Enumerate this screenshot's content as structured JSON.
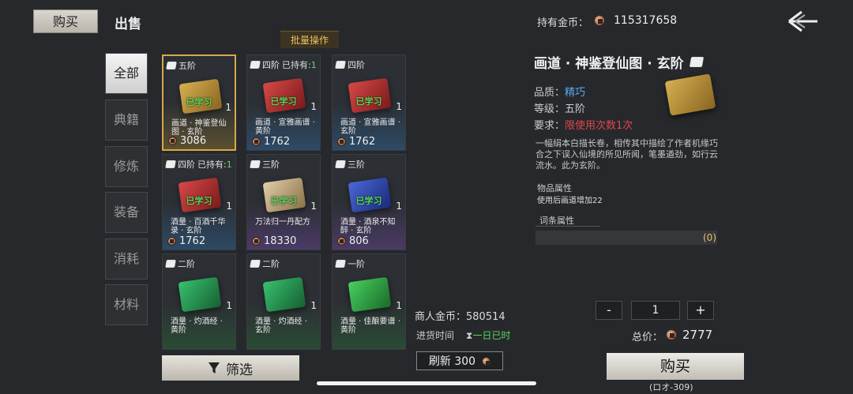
{
  "header": {
    "tab_buy": "购买",
    "tab_sell": "出售",
    "gold_label": "持有金币：",
    "gold_value": "115317658",
    "batch_label": "批量操作"
  },
  "categories": [
    "全部",
    "典籍",
    "修炼",
    "装备",
    "消耗",
    "材料"
  ],
  "items": [
    {
      "tier": "五阶",
      "owned_label": "",
      "owned_count": "",
      "learned": "已学习",
      "qty": "1",
      "name": "画道 · 神鉴登仙图 · 玄阶",
      "price": "3086"
    },
    {
      "tier": "四阶",
      "owned_label": "已持有:",
      "owned_count": "1",
      "learned": "已学习",
      "qty": "1",
      "name": "画道 · 宣雅画谱 · 黄阶",
      "price": "1762"
    },
    {
      "tier": "四阶",
      "owned_label": "",
      "owned_count": "",
      "learned": "已学习",
      "qty": "1",
      "name": "画道 · 宣雅画谱 · 玄阶",
      "price": "1762"
    },
    {
      "tier": "四阶",
      "owned_label": "已持有:",
      "owned_count": "1",
      "learned": "已学习",
      "qty": "1",
      "name": "酒量 · 百酒千华录 · 玄阶",
      "price": "1762"
    },
    {
      "tier": "三阶",
      "owned_label": "",
      "owned_count": "",
      "learned": "已学习",
      "qty": "1",
      "name": "万法归一丹配方",
      "price": "18330"
    },
    {
      "tier": "三阶",
      "owned_label": "",
      "owned_count": "",
      "learned": "已学习",
      "qty": "1",
      "name": "酒量 · 酒泉不知醉 · 玄阶",
      "price": "806"
    },
    {
      "tier": "二阶",
      "owned_label": "",
      "owned_count": "",
      "learned": "",
      "qty": "1",
      "name": "酒量 · 灼酒经 · 黄阶",
      "price": ""
    },
    {
      "tier": "二阶",
      "owned_label": "",
      "owned_count": "",
      "learned": "",
      "qty": "1",
      "name": "酒量 · 灼酒经 · 玄阶",
      "price": ""
    },
    {
      "tier": "一阶",
      "owned_label": "",
      "owned_count": "",
      "learned": "",
      "qty": "1",
      "name": "酒量 · 佳酿要谱 · 黄阶",
      "price": ""
    }
  ],
  "merchant": {
    "gold_label": "商人金币：",
    "gold_value": "580514",
    "restock_label": "进货时间",
    "restock_time": "一日已时",
    "refresh_label": "刷新 300",
    "filter_label": "筛选"
  },
  "detail": {
    "title": "画道 · 神鉴登仙图 · 玄阶",
    "quality_label": "品质：",
    "quality_value": "精巧",
    "level_label": "等级：",
    "level_value": "五阶",
    "require_label": "要求：",
    "require_value": "限使用次数1次",
    "description": "一幅绢本白描长卷，相传其中描绘了作者机缘巧合之下误入仙境的所见所闻，笔墨遒劲，如行云流水。此为玄阶。",
    "attr_title": "物品属性",
    "attr_text": "使用后画道增加22",
    "affix_title": "词条属性",
    "affix_count": "(0)"
  },
  "purchase": {
    "minus": "-",
    "plus": "+",
    "quantity": "1",
    "total_label": "总价：",
    "total_value": "2777",
    "buy_label": "购买",
    "buy_sub": "(ロオ-309)"
  },
  "colors": {
    "learned": "#58d858",
    "quality": "#5aa8f0",
    "require": "#e04848",
    "selected_border": "#d8a84a"
  }
}
